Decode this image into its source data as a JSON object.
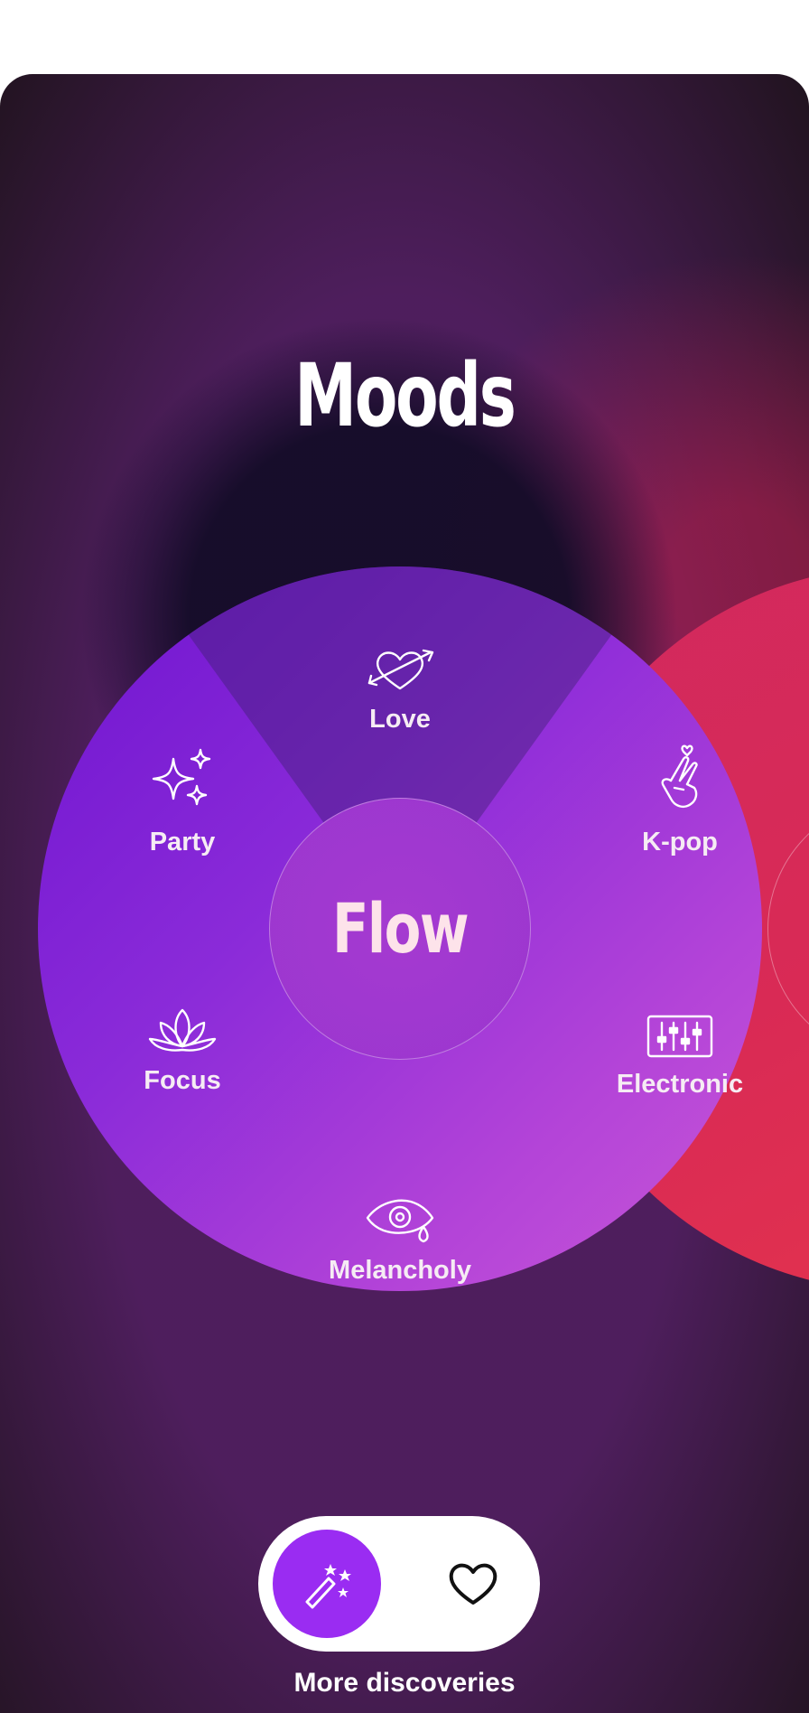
{
  "page": {
    "title": "Moods",
    "caption": "More discoveries"
  },
  "wheels": [
    {
      "center_label": "Flow",
      "color": "#8b2bd9",
      "moods": [
        {
          "label": "Love",
          "icon": "heart-arrow-icon"
        },
        {
          "label": "Party",
          "icon": "sparkles-icon"
        },
        {
          "label": "Focus",
          "icon": "lotus-icon"
        },
        {
          "label": "Melancholy",
          "icon": "crying-eye-icon"
        }
      ]
    },
    {
      "center_label": "",
      "color": "#d92a55",
      "moods": [
        {
          "label": "K-pop",
          "icon": "finger-heart-icon"
        },
        {
          "label": "Electronic",
          "icon": "equalizer-icon"
        }
      ]
    }
  ],
  "tabbar": {
    "discover_icon": "magic-wand-icon",
    "favorites_icon": "heart-icon",
    "active_color": "#9a2cf2"
  }
}
